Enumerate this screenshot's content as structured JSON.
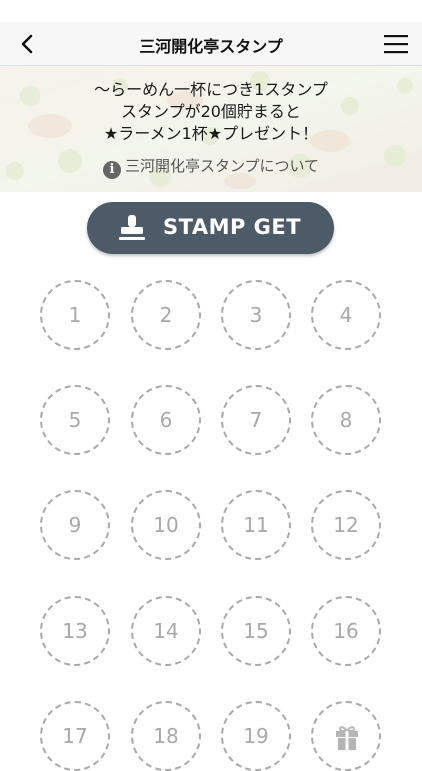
{
  "header": {
    "title": "三河開化亭スタンプ"
  },
  "banner": {
    "line1": "〜らーめん一杯につき1スタンプ",
    "line2": "スタンプが20個貯まると",
    "line3": "★ラーメン1杯★プレゼント！",
    "info_link": "三河開化亭スタンプについて"
  },
  "stamp_button": {
    "label": "STAMP GET"
  },
  "stamp_slots": [
    "1",
    "2",
    "3",
    "4",
    "5",
    "6",
    "7",
    "8",
    "9",
    "10",
    "11",
    "12",
    "13",
    "14",
    "15",
    "16",
    "17",
    "18",
    "19"
  ],
  "reward_slot_icon": "gift-icon",
  "colors": {
    "button": "#4d5b69",
    "slot_border": "#a9a9a9",
    "slot_text": "#a8a8a8",
    "navbar": "#f7f7f7"
  }
}
